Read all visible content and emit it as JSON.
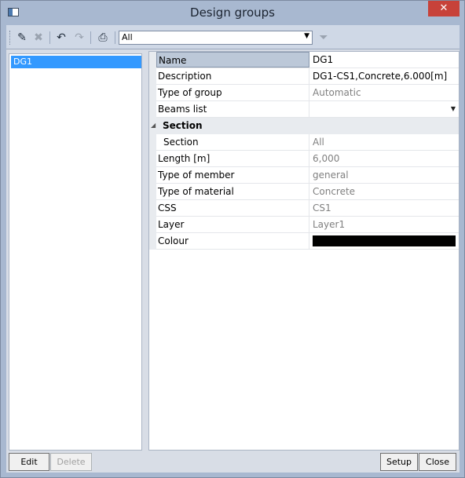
{
  "window": {
    "title": "Design groups",
    "close_glyph": "✕"
  },
  "toolbar": {
    "filter_value": "All",
    "icons": [
      "edit-icon",
      "delete-icon",
      "undo-icon",
      "redo-icon",
      "print-icon",
      "filter-icon"
    ]
  },
  "list": {
    "items": [
      {
        "label": "DG1"
      }
    ]
  },
  "properties": {
    "name": {
      "label": "Name",
      "value": "DG1"
    },
    "description": {
      "label": "Description",
      "value": "DG1-CS1,Concrete,6.000[m]"
    },
    "type_of_group": {
      "label": "Type of group",
      "value": "Automatic"
    },
    "beams_list": {
      "label": "Beams list",
      "value": ""
    },
    "section_category": {
      "label": "Section"
    },
    "section": {
      "label": "Section",
      "value": "All"
    },
    "length": {
      "label": "Length [m]",
      "value": "6,000"
    },
    "type_of_member": {
      "label": "Type of member",
      "value": "general"
    },
    "type_of_material": {
      "label": "Type of material",
      "value": "Concrete"
    },
    "css": {
      "label": "CSS",
      "value": "CS1"
    },
    "layer": {
      "label": "Layer",
      "value": "Layer1"
    },
    "colour": {
      "label": "Colour",
      "value_color": "#000000"
    }
  },
  "buttons": {
    "edit": "Edit",
    "delete": "Delete",
    "setup": "Setup",
    "close": "Close"
  }
}
